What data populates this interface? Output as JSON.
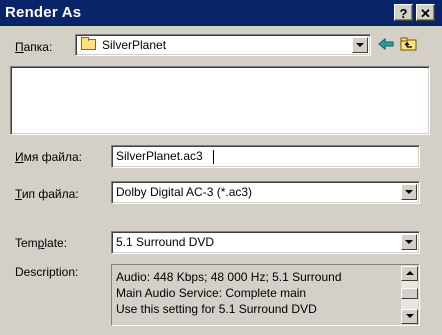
{
  "window": {
    "title": "Render As",
    "help_label": "?",
    "close_label": "✕"
  },
  "location": {
    "label": "Папка:",
    "folder": "SilverPlanet",
    "back_icon": "back-arrow-icon",
    "up_icon": "up-folder-icon"
  },
  "filename": {
    "label": "Имя файла:",
    "value": "SilverPlanet.ac3"
  },
  "filetype": {
    "label": "Тип файла:",
    "value": "Dolby Digital AC-3 (*.ac3)"
  },
  "template": {
    "label": "Template:",
    "value": "5.1 Surround DVD"
  },
  "description": {
    "label": "Description:",
    "lines": [
      "Audio: 448 Kbps; 48 000 Hz; 5.1 Surround",
      "Main Audio Service: Complete main",
      "Use this setting for 5.1 Surround DVD"
    ]
  },
  "colors": {
    "title_bar": "#0a246a",
    "dialog_bg": "#d4d0c8"
  }
}
